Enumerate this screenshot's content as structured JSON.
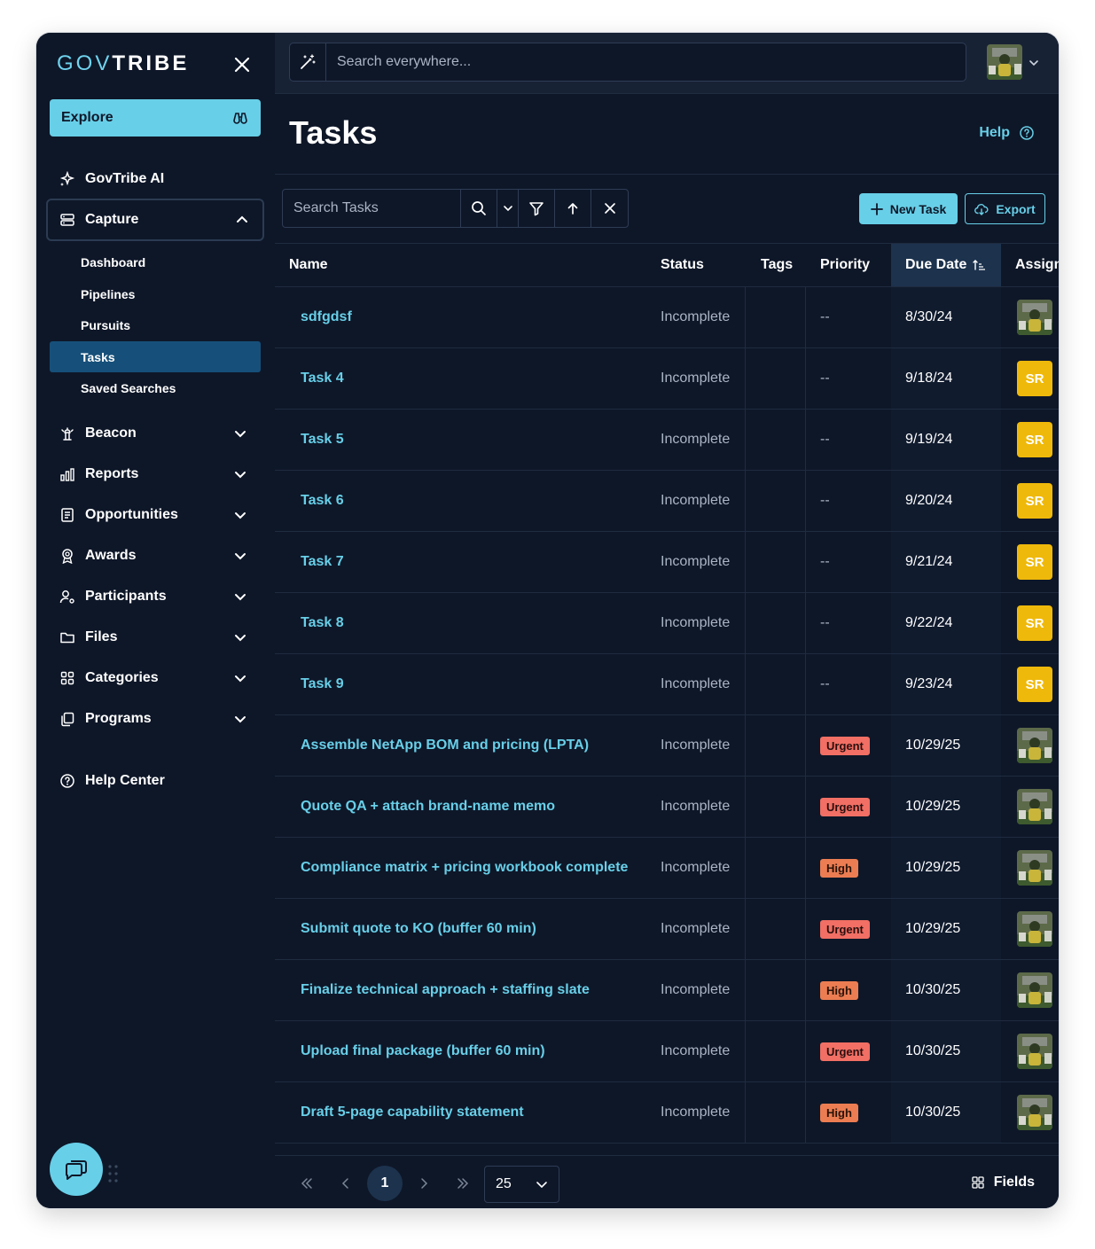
{
  "brand": {
    "part1": "GOV",
    "part2": "TRIBE"
  },
  "sidebar": {
    "explore_label": "Explore",
    "govtribe_ai": "GovTribe AI",
    "capture": "Capture",
    "capture_items": [
      "Dashboard",
      "Pipelines",
      "Pursuits",
      "Tasks",
      "Saved Searches"
    ],
    "sections": [
      "Beacon",
      "Reports",
      "Opportunities",
      "Awards",
      "Participants",
      "Files",
      "Categories",
      "Programs"
    ],
    "help_center": "Help Center"
  },
  "topbar": {
    "search_placeholder": "Search everywhere..."
  },
  "page": {
    "title": "Tasks",
    "help_label": "Help"
  },
  "toolbar": {
    "search_placeholder": "Search Tasks",
    "new_task": "New Task",
    "export": "Export"
  },
  "table": {
    "headers": {
      "name": "Name",
      "status": "Status",
      "tags": "Tags",
      "priority": "Priority",
      "due_date": "Due Date",
      "assignee": "Assign"
    },
    "rows": [
      {
        "name": "sdfgdsf",
        "status": "Incomplete",
        "priority": "--",
        "due": "8/30/24",
        "assignee": "photo"
      },
      {
        "name": "Task 4",
        "status": "Incomplete",
        "priority": "--",
        "due": "9/18/24",
        "assignee": "SR"
      },
      {
        "name": "Task 5",
        "status": "Incomplete",
        "priority": "--",
        "due": "9/19/24",
        "assignee": "SR"
      },
      {
        "name": "Task 6",
        "status": "Incomplete",
        "priority": "--",
        "due": "9/20/24",
        "assignee": "SR"
      },
      {
        "name": "Task 7",
        "status": "Incomplete",
        "priority": "--",
        "due": "9/21/24",
        "assignee": "SR"
      },
      {
        "name": "Task 8",
        "status": "Incomplete",
        "priority": "--",
        "due": "9/22/24",
        "assignee": "SR"
      },
      {
        "name": "Task 9",
        "status": "Incomplete",
        "priority": "--",
        "due": "9/23/24",
        "assignee": "SR"
      },
      {
        "name": "Assemble NetApp BOM and pricing (LPTA)",
        "status": "Incomplete",
        "priority": "Urgent",
        "due": "10/29/25",
        "assignee": "photo"
      },
      {
        "name": "Quote QA + attach brand-name memo",
        "status": "Incomplete",
        "priority": "Urgent",
        "due": "10/29/25",
        "assignee": "photo"
      },
      {
        "name": "Compliance matrix + pricing workbook complete",
        "status": "Incomplete",
        "priority": "High",
        "due": "10/29/25",
        "assignee": "photo"
      },
      {
        "name": "Submit quote to KO (buffer 60 min)",
        "status": "Incomplete",
        "priority": "Urgent",
        "due": "10/29/25",
        "assignee": "photo"
      },
      {
        "name": "Finalize technical approach + staffing slate",
        "status": "Incomplete",
        "priority": "High",
        "due": "10/30/25",
        "assignee": "photo"
      },
      {
        "name": "Upload final package (buffer 60 min)",
        "status": "Incomplete",
        "priority": "Urgent",
        "due": "10/30/25",
        "assignee": "photo"
      },
      {
        "name": "Draft 5-page capability statement",
        "status": "Incomplete",
        "priority": "High",
        "due": "10/30/25",
        "assignee": "photo"
      }
    ]
  },
  "pagination": {
    "current_page": "1",
    "page_size": "25",
    "fields_label": "Fields"
  },
  "colors": {
    "accent": "#68cfe8",
    "background": "#0e1728",
    "active_nav": "#16507a",
    "urgent": "#f16f64",
    "high": "#ec7d52",
    "initials_badge": "#efb90b"
  }
}
